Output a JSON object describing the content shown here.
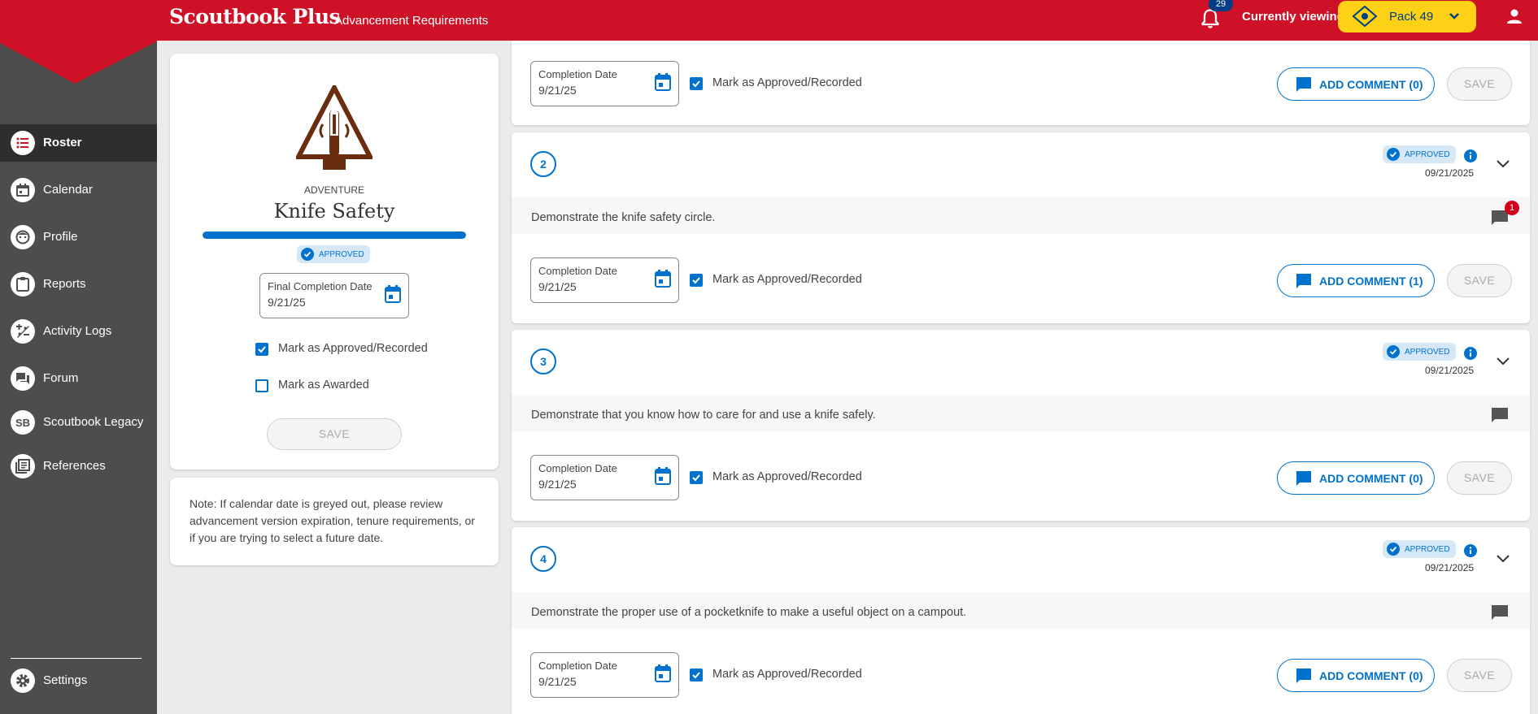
{
  "header": {
    "brand": "Scoutbook Plus",
    "subtitle": "Advancement Requirements",
    "notification_count": "29",
    "viewing_label": "Currently viewing:",
    "unit_name": "Pack 49"
  },
  "sidebar": {
    "items": [
      {
        "label": "Roster",
        "icon": "list-icon",
        "active": true
      },
      {
        "label": "Calendar",
        "icon": "calendar-icon"
      },
      {
        "label": "Profile",
        "icon": "face-icon"
      },
      {
        "label": "Reports",
        "icon": "clipboard-icon"
      },
      {
        "label": "Activity Logs",
        "icon": "activity-icon"
      },
      {
        "label": "Forum",
        "icon": "forum-icon"
      },
      {
        "label": "Scoutbook Legacy",
        "icon": "sb-icon",
        "icon_text": "SB"
      },
      {
        "label": "References",
        "icon": "references-icon"
      }
    ],
    "settings_label": "Settings"
  },
  "adventure": {
    "type": "ADVENTURE",
    "name": "Knife Safety",
    "progress": 1.0,
    "status": "APPROVED",
    "final_date_label": "Final Completion Date",
    "final_date_value": "9/21/25",
    "mark_approved_label": "Mark as Approved/Recorded",
    "mark_approved_checked": true,
    "mark_awarded_label": "Mark as Awarded",
    "mark_awarded_checked": false,
    "save_label": "SAVE"
  },
  "note": "Note: If calendar date is greyed out, please review advancement version expiration, tenure requirements, or if you are trying to select a future date.",
  "requirements_common": {
    "completion_label": "Completion Date",
    "approved_label": "Mark as Approved/Recorded",
    "save_label": "SAVE"
  },
  "requirements": [
    {
      "completion_date": "9/21/25",
      "add_comment": "ADD COMMENT (0)"
    },
    {
      "number": "2",
      "status": "APPROVED",
      "date": "09/21/2025",
      "description": "Demonstrate the knife safety circle.",
      "comment_count": "1",
      "completion_date": "9/21/25",
      "add_comment": "ADD COMMENT (1)"
    },
    {
      "number": "3",
      "status": "APPROVED",
      "date": "09/21/2025",
      "description": "Demonstrate that you know how to care for and use a knife safely.",
      "completion_date": "9/21/25",
      "add_comment": "ADD COMMENT (0)"
    },
    {
      "number": "4",
      "status": "APPROVED",
      "date": "09/21/2025",
      "description": "Demonstrate the proper use of a pocketknife to make a useful object on a campout.",
      "completion_date": "9/21/25",
      "add_comment": "ADD COMMENT (0)"
    }
  ],
  "colors": {
    "header_red": "#ce1126",
    "sidebar_gray": "#4d4d4d",
    "accent_blue": "#0072ce",
    "unit_yellow": "#fcd116",
    "emblem_brown": "#6b2d0f"
  }
}
